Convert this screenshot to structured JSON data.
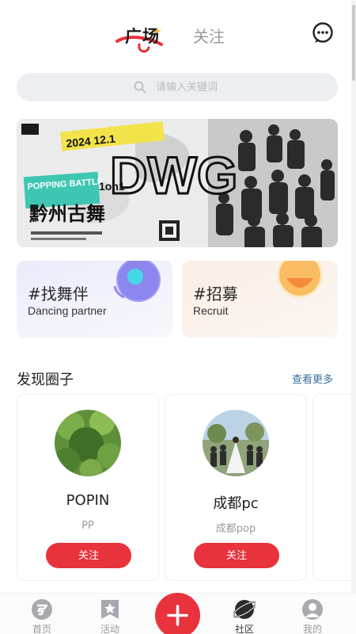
{
  "header": {
    "tab_active": "广场",
    "tab_inactive": "关注",
    "message_icon": "chat-bubble-icon"
  },
  "search": {
    "placeholder": "请输入关键词",
    "icon": "search-icon"
  },
  "banner": {
    "date_text": "2024 12.1",
    "title_text": "黔州古舞",
    "battle_text": "POPPING BATTLE",
    "format_text": "1on1"
  },
  "cards": [
    {
      "title": "#找舞伴",
      "subtitle": "Dancing partner"
    },
    {
      "title": "#招募",
      "subtitle": "Recruit"
    }
  ],
  "section": {
    "title": "发现圈子",
    "more": "查看更多"
  },
  "circles": [
    {
      "name": "POPIN",
      "desc": "PP",
      "follow_label": "关注"
    },
    {
      "name": "成都pc",
      "desc": "成都pop",
      "follow_label": "关注"
    }
  ],
  "bottom_nav": [
    {
      "label": "首页",
      "icon": "home-icon"
    },
    {
      "label": "活动",
      "icon": "bookmark-star-icon"
    },
    {
      "label": "",
      "icon": "plus-icon"
    },
    {
      "label": "社区",
      "icon": "planet-icon"
    },
    {
      "label": "我的",
      "icon": "user-icon"
    }
  ],
  "colors": {
    "accent": "#e8333c",
    "link": "#3a6f9e",
    "search_bg": "#eceef2"
  }
}
